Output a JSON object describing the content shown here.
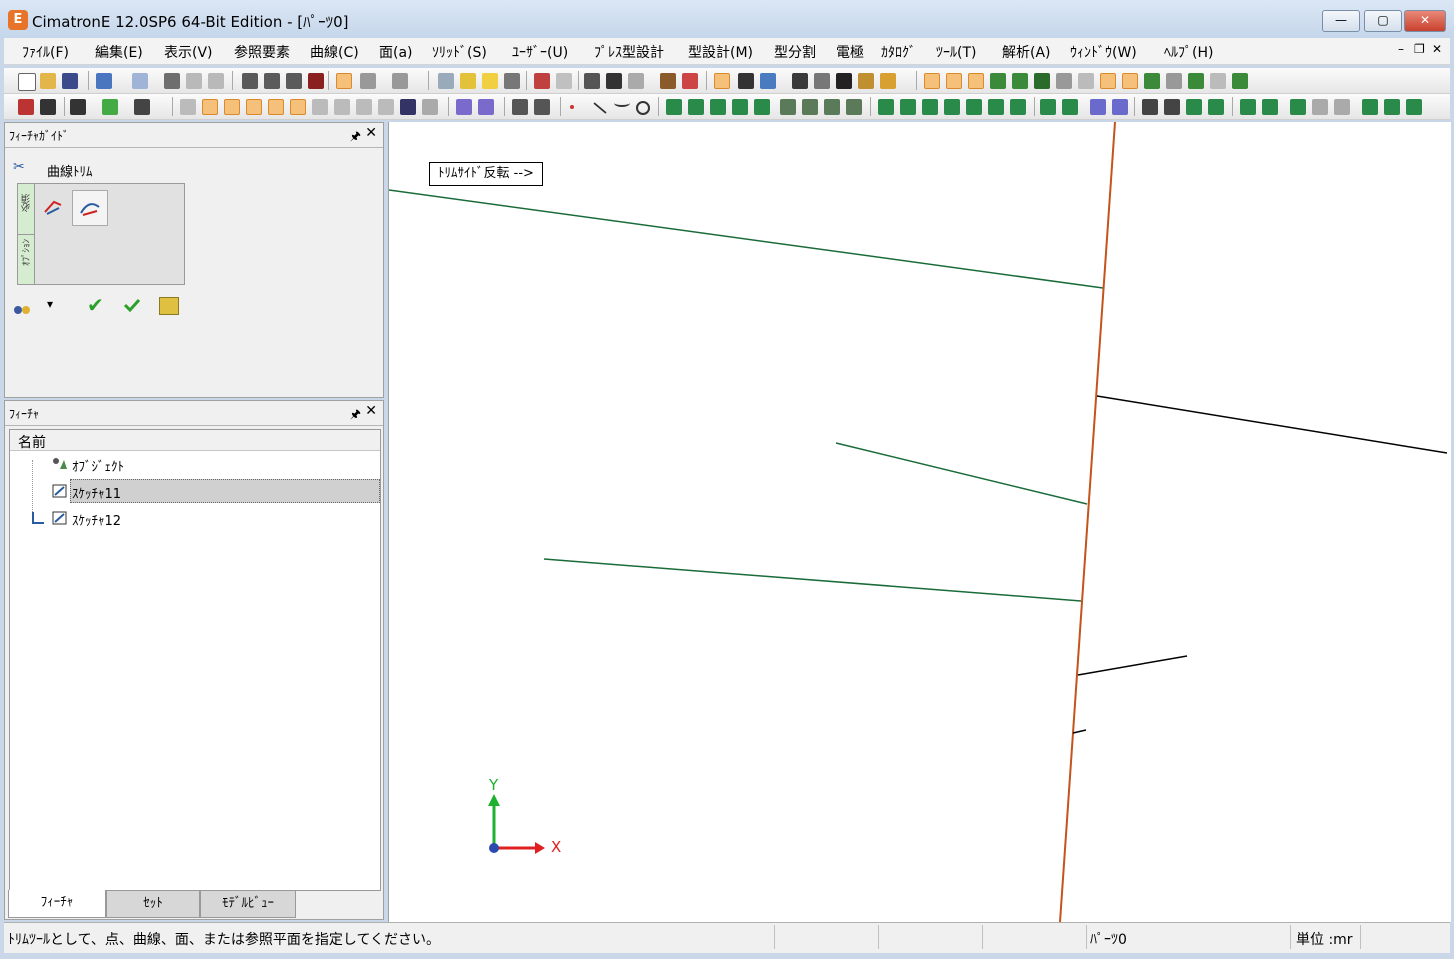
{
  "window": {
    "title": "CimatronE 12.0SP6  64-Bit Edition - [ﾊﾟｰﾂ0]",
    "app_icon_text": "E",
    "minimize": "—",
    "maximize": "▢",
    "close": "✕"
  },
  "menu": [
    "ﾌｧｲﾙ(F)",
    "編集(E)",
    "表示(V)",
    "参照要素",
    "曲線(C)",
    "面(a)",
    "ｿﾘｯﾄﾞ(S)",
    "ﾕｰｻﾞｰ(U)",
    "ﾌﾟﾚｽ型設計",
    "型設計(M)",
    "型分割",
    "電極",
    "ｶﾀﾛｸﾞ",
    "ﾂｰﾙ(T)",
    "解析(A)",
    "ｳｨﾝﾄﾞｳ(W)",
    "ﾍﾙﾌﾟ(H)"
  ],
  "menu_controls": {
    "minimize": "–",
    "restore": "❐",
    "close": "✕"
  },
  "feature_guide": {
    "title": "ﾌｨｰﾁｬｶﾞｲﾄﾞ",
    "pin": "🖈",
    "close": "✕",
    "command_name": "曲線ﾄﾘﾑ",
    "required_label": "必須",
    "optional_label": "ｵﾌﾟｼｮﾝ",
    "dropdown_arrow": "▾",
    "apply_symbol": "✔"
  },
  "feature_tree": {
    "title": "ﾌｨｰﾁｬ",
    "pin": "🖈",
    "close": "✕",
    "column_header": "名前",
    "items": [
      {
        "label": "ｵﾌﾞｼﾞｪｸﾄ",
        "selected": false
      },
      {
        "label": "ｽｹｯﾁｬ11",
        "selected": true
      },
      {
        "label": "ｽｹｯﾁｬ12",
        "selected": false
      }
    ]
  },
  "bottom_tabs": [
    "ﾌｨｰﾁｬ",
    "ｾｯﾄ",
    "ﾓﾃﾞﾙﾋﾞｭｰ"
  ],
  "viewport": {
    "tooltip": "ﾄﾘﾑｻｲﾄﾞ反転 -->",
    "axis_x": "X",
    "axis_y": "Y",
    "colors": {
      "sketch_lines": "#1a6b3a",
      "trim_line": "#c4531c",
      "black_lines": "#000000",
      "axis_x": "#e02020",
      "axis_y": "#20b030"
    }
  },
  "status": {
    "message": "ﾄﾘﾑﾂｰﾙとして、点、曲線、面、または参照平面を指定してください。",
    "part": "ﾊﾟｰﾂ0",
    "units": "単位 :mr"
  }
}
